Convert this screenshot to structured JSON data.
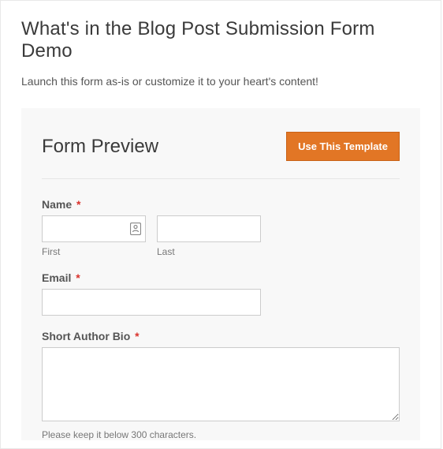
{
  "page": {
    "title": "What's in the Blog Post Submission Form Demo",
    "intro": "Launch this form as-is or customize it to your heart's content!"
  },
  "form": {
    "title": "Form Preview",
    "button": "Use This Template",
    "required_marker": "*",
    "fields": {
      "name": {
        "label": "Name",
        "first_sub": "First",
        "last_sub": "Last"
      },
      "email": {
        "label": "Email"
      },
      "bio": {
        "label": "Short Author Bio",
        "hint": "Please keep it below 300 characters."
      }
    }
  }
}
